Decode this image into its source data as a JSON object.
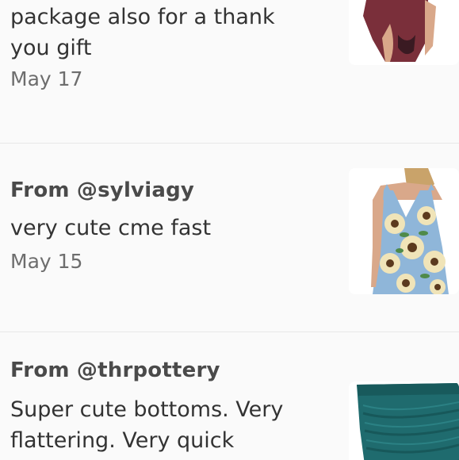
{
  "reviews": [
    {
      "author": "",
      "body_lines": [
        "package also for a thank",
        "you gift"
      ],
      "date": "May 17",
      "thumb_icon": "product-thumbnail-lingerie",
      "thumb_colors": {
        "bg": "#ffffff",
        "fabric": "#7a2f3a",
        "skin": "#d9a88a"
      }
    },
    {
      "author": "From @sylviagy",
      "body_lines": [
        "very cute cme fast"
      ],
      "date": "May 15",
      "thumb_icon": "product-thumbnail-sunflower-dress",
      "thumb_colors": {
        "bg": "#ffffff",
        "fabric": "#8fb6d9",
        "flower": "#f0e4b8",
        "skin": "#d9a88a"
      }
    },
    {
      "author": "From @thrpottery",
      "body_lines": [
        "Super cute bottoms. Very",
        "flattering. Very quick"
      ],
      "date": "",
      "thumb_icon": "product-thumbnail-teal-swim-bottoms",
      "thumb_colors": {
        "bg": "#ffffff",
        "fabric": "#1f6b6e"
      }
    }
  ]
}
